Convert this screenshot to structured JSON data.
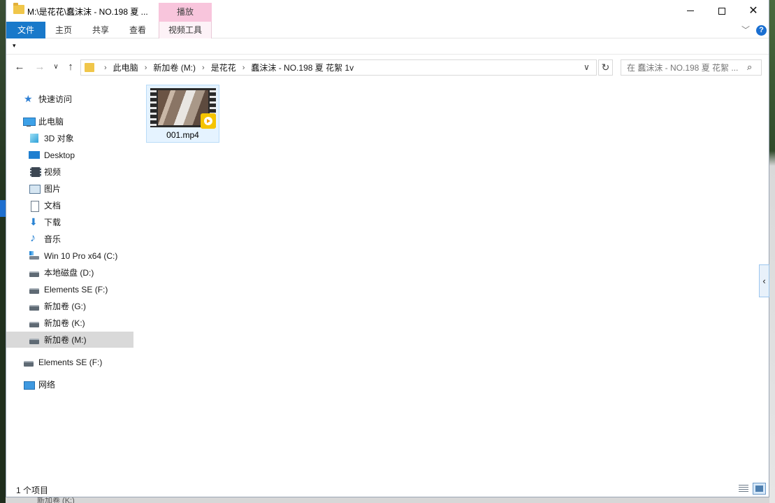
{
  "window": {
    "title": "M:\\是花花\\蠢沫沫 - NO.198 夏 ...",
    "context_tab_group": "播放"
  },
  "ribbon": {
    "tabs": [
      {
        "label": "文件"
      },
      {
        "label": "主页"
      },
      {
        "label": "共享"
      },
      {
        "label": "查看"
      },
      {
        "label": "视频工具"
      }
    ]
  },
  "address": {
    "crumbs": [
      "此电脑",
      "新加卷 (M:)",
      "是花花",
      "蠢沫沫 - NO.198 夏 花絮 1v"
    ]
  },
  "search": {
    "placeholder": "在 蠢沫沫 - NO.198 夏 花絮 ..."
  },
  "navpane": {
    "quick_access": "快速访问",
    "this_pc": "此电脑",
    "items": [
      {
        "label": "3D 对象",
        "icon": "3d-objects-icon"
      },
      {
        "label": "Desktop",
        "icon": "desktop-icon"
      },
      {
        "label": "视频",
        "icon": "videos-icon"
      },
      {
        "label": "图片",
        "icon": "pictures-icon"
      },
      {
        "label": "文档",
        "icon": "documents-icon"
      },
      {
        "label": "下载",
        "icon": "downloads-icon"
      },
      {
        "label": "音乐",
        "icon": "music-icon"
      },
      {
        "label": "Win 10 Pro x64 (C:)",
        "icon": "system-drive-icon"
      },
      {
        "label": "本地磁盘 (D:)",
        "icon": "drive-icon"
      },
      {
        "label": "Elements SE (F:)",
        "icon": "drive-icon"
      },
      {
        "label": "新加卷 (G:)",
        "icon": "drive-icon"
      },
      {
        "label": "新加卷 (K:)",
        "icon": "drive-icon"
      },
      {
        "label": "新加卷 (M:)",
        "icon": "drive-icon",
        "selected": true
      }
    ],
    "external": "Elements SE (F:)",
    "network": "网络"
  },
  "files": [
    {
      "name": "001.mp4",
      "badge": "Player"
    }
  ],
  "status": {
    "item_count": "1 个项目"
  },
  "desktop_bottom": "新加卷 (K:)"
}
